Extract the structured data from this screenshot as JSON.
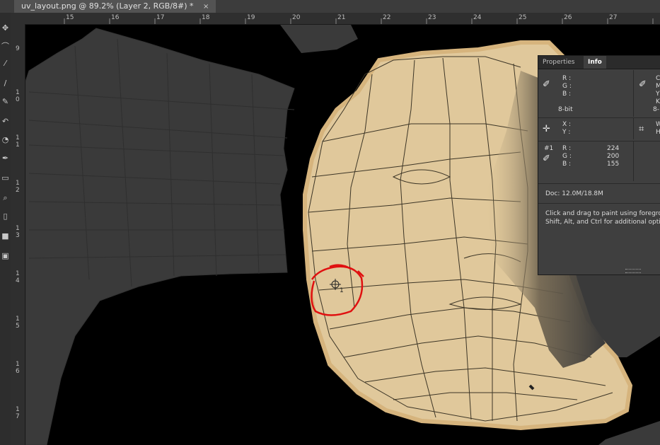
{
  "document_tab": {
    "title": "uv_layout.png @ 89.2% (Layer 2, RGB/8#) *",
    "close": "×"
  },
  "ruler": {
    "top_labels": [
      "15",
      "16",
      "17",
      "18",
      "19",
      "20",
      "21",
      "22",
      "23",
      "24",
      "25",
      "26",
      "27"
    ],
    "left_labels": [
      "9",
      "1\n0",
      "1\n1",
      "1\n2",
      "1\n3",
      "1\n4",
      "1\n5",
      "1\n6",
      "1\n7"
    ]
  },
  "info_panel": {
    "tabs": [
      "Properties",
      "Info"
    ],
    "rgb_block": {
      "r": "R :",
      "g": "G :",
      "b": "B :",
      "bit": "8-bit"
    },
    "cmyk_block": {
      "c": "C",
      "m": "M",
      "y": "Y",
      "k": "K",
      "bit": "8-"
    },
    "xy_block": {
      "x": "X :",
      "y": "Y :"
    },
    "wh_block": {
      "w": "W",
      "h": "H"
    },
    "sample": {
      "id": "#1",
      "r_label": "R :",
      "g_label": "G :",
      "b_label": "B :",
      "r": "224",
      "g": "200",
      "b": "155"
    },
    "doc_size": "Doc: 12.0M/18.8M",
    "hint_line1": "Click and drag to paint using foregro",
    "hint_line2": "Shift, Alt, and Ctrl for additional optio"
  },
  "cursor_label": "1",
  "colors": {
    "skin": "#e0c89b",
    "skin_edge": "#d6b47d",
    "mesh_gray": "#3a3a3a",
    "annotation_red": "#e01010",
    "panel_bg": "#3f3f3f"
  }
}
